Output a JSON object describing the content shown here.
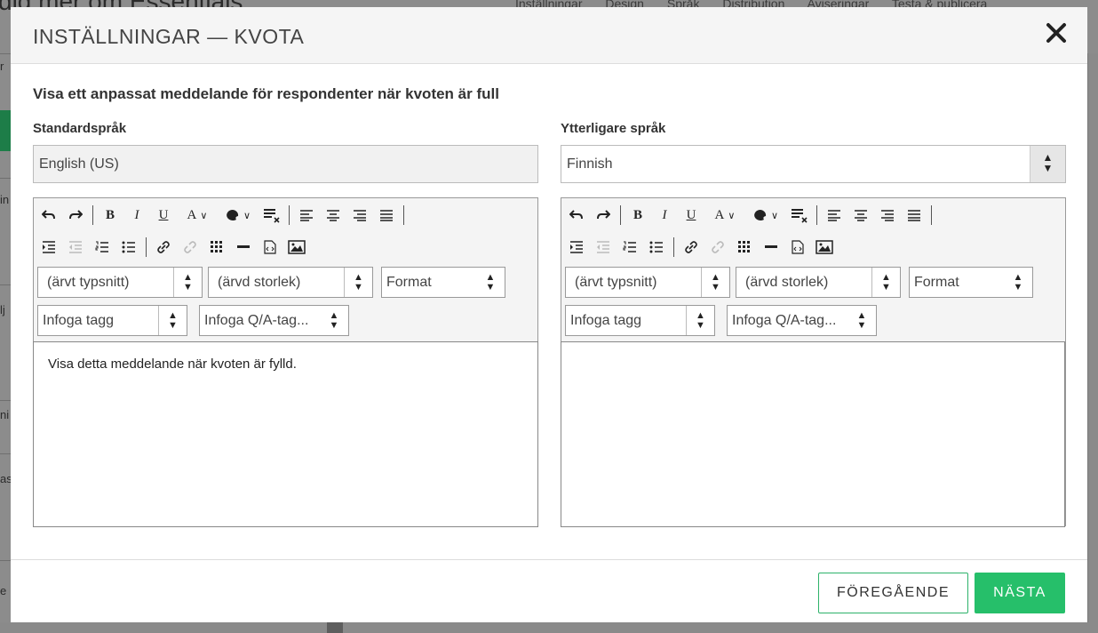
{
  "background": {
    "title": "dig mer om Essentials",
    "nav": [
      "Inställningar",
      "Design",
      "Språk",
      "Distribution",
      "Aviseringar",
      "Testa & publicera"
    ],
    "left_fragments": [
      "r",
      "in",
      "lj",
      "ni",
      "as",
      "e"
    ]
  },
  "modal": {
    "title": "INSTÄLLNINGAR — KVOTA",
    "close_label": "✕",
    "subtitle": "Visa ett anpassat meddelande för respondenter när kvoten är full",
    "left": {
      "label": "Standardspråk",
      "language": "English (US)",
      "font_select": "(ärvt typsnitt)",
      "size_select": "(ärvd storlek)",
      "format_select": "Format",
      "insert_tag": "Infoga tagg",
      "insert_qa_tag": "Infoga Q/A-tag...",
      "content": "Visa detta meddelande när kvoten är fylld."
    },
    "right": {
      "label": "Ytterligare språk",
      "language": "Finnish",
      "font_select": "(ärvt typsnitt)",
      "size_select": "(ärvd storlek)",
      "format_select": "Format",
      "insert_tag": "Infoga tagg",
      "insert_qa_tag": "Infoga Q/A-tag...",
      "content": ""
    },
    "toolbar": {
      "undo": "↶",
      "redo": "↷",
      "bold": "B",
      "italic": "I",
      "underline": "U",
      "font_color": "A",
      "bg_color": "◕",
      "clear_format": "≡"
    },
    "footer": {
      "prev_label": "FÖREGÅENDE",
      "next_label": "NÄSTA"
    }
  },
  "colors": {
    "accent": "#26bf6a",
    "overlay": "#8c8c8c"
  }
}
